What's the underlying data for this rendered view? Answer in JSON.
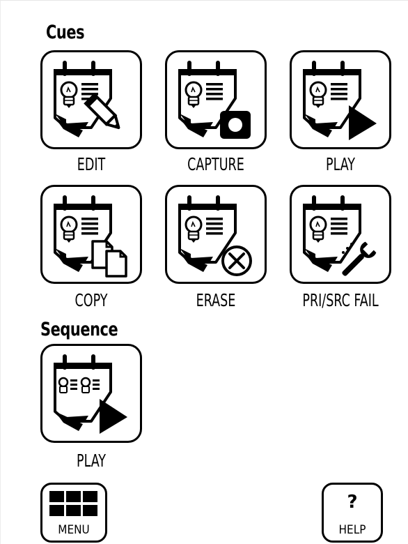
{
  "sections": {
    "cues_title": "Cues",
    "sequence_title": "Sequence"
  },
  "cues": [
    {
      "label": "EDIT",
      "icon": "cue-edit-icon"
    },
    {
      "label": "CAPTURE",
      "icon": "cue-capture-icon"
    },
    {
      "label": "PLAY",
      "icon": "cue-play-icon"
    },
    {
      "label": "COPY",
      "icon": "cue-copy-icon"
    },
    {
      "label": "ERASE",
      "icon": "cue-erase-icon"
    },
    {
      "label": "PRI/SRC FAIL",
      "icon": "cue-pri-src-fail-icon"
    }
  ],
  "sequence": [
    {
      "label": "PLAY",
      "icon": "sequence-play-icon"
    }
  ],
  "footer": {
    "menu_label": "MENU",
    "help_symbol": "?",
    "help_label": "HELP"
  }
}
